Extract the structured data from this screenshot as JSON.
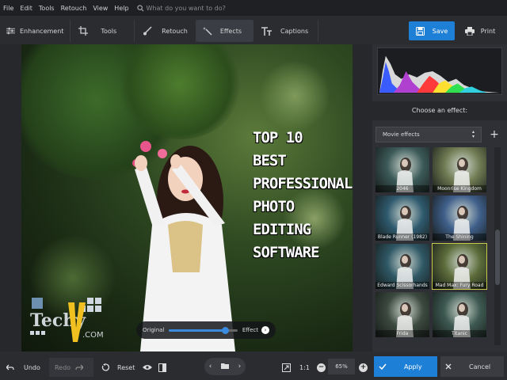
{
  "menu": [
    "File",
    "Edit",
    "Tools",
    "Retouch",
    "View",
    "Help"
  ],
  "search": {
    "placeholder": "What do you want to do?"
  },
  "tabs": [
    {
      "label": "Enhancement",
      "icon": "sliders-icon"
    },
    {
      "label": "Tools",
      "icon": "crop-icon"
    },
    {
      "label": "Retouch",
      "icon": "brush-icon"
    },
    {
      "label": "Effects",
      "icon": "magic-wand-icon",
      "active": true
    },
    {
      "label": "Captions",
      "icon": "text-icon"
    }
  ],
  "save_label": "Save",
  "print_label": "Print",
  "photo_title_lines": [
    "TOP 10",
    "BEST",
    "PROFESSIONAL",
    "PHOTO",
    "EDITING",
    "SOFTWARE"
  ],
  "slider": {
    "left": "Original",
    "right": "Effect",
    "value": 0.82
  },
  "logo": {
    "text": "Techy",
    "sub": ".COM"
  },
  "panel": {
    "choose": "Choose an effect:",
    "dropdown": "Movie effects"
  },
  "effects": [
    {
      "label": "2046",
      "color": "#3c5a58"
    },
    {
      "label": "Moonrise Kingdom",
      "color": "#6f7a52"
    },
    {
      "label": "Blade Runner (1982)",
      "color": "#2f5a6e"
    },
    {
      "label": "The Shining",
      "color": "#3f5f8a"
    },
    {
      "label": "Edward Scissorhands",
      "color": "#2f5866"
    },
    {
      "label": "Mad Max: Fury Road",
      "color": "#5c6c3a",
      "selected": true
    },
    {
      "label": "Frida",
      "color": "#3c4a40"
    },
    {
      "label": "Titanic",
      "color": "#3e5a52"
    }
  ],
  "bottom": {
    "undo": "Undo",
    "redo": "Redo",
    "reset": "Reset",
    "ratio": "1:1",
    "zoom": "65%",
    "apply": "Apply",
    "cancel": "Cancel"
  },
  "colors": {
    "accent": "#1e7fd6",
    "panel": "#2e3035",
    "bar": "#2a2c30"
  }
}
